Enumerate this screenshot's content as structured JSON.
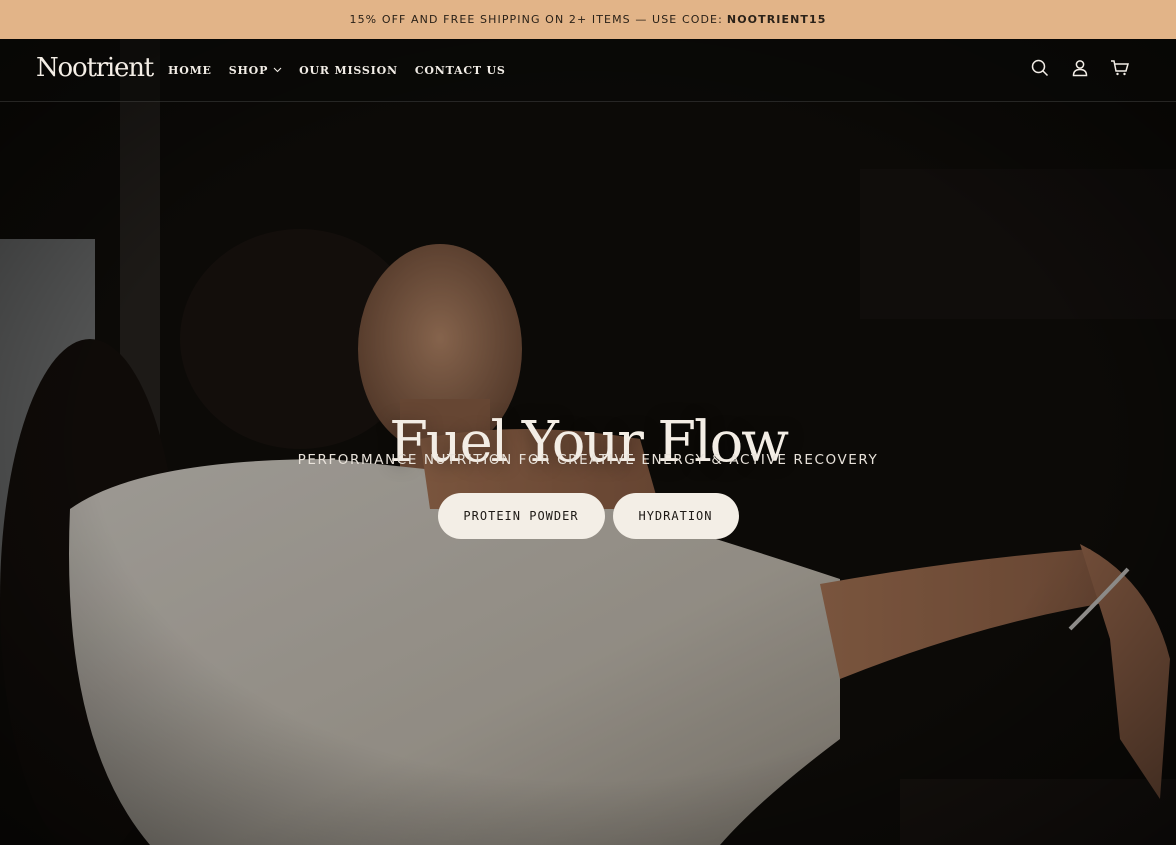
{
  "announcement": {
    "text": "15% OFF AND FREE SHIPPING ON 2+ ITEMS — USE CODE:",
    "code": "NOOTRIENT15"
  },
  "header": {
    "logo": "Nootrient",
    "nav": [
      {
        "label": "HOME"
      },
      {
        "label": "SHOP",
        "has_dropdown": true
      },
      {
        "label": "OUR MISSION"
      },
      {
        "label": "CONTACT US"
      }
    ],
    "icons": [
      "search-icon",
      "account-icon",
      "cart-icon"
    ]
  },
  "hero": {
    "title": "Fuel Your Flow",
    "subtitle": "PERFORMANCE NUTRITION FOR CREATIVE ENERGY & ACTIVE RECOVERY",
    "buttons": [
      "PROTEIN POWDER",
      "HYDRATION"
    ]
  },
  "colors": {
    "announcement_bg": "#e2b488",
    "header_bg": "#0d0b09",
    "button_bg": "#f3eee6",
    "text_light": "#f3ede5"
  }
}
